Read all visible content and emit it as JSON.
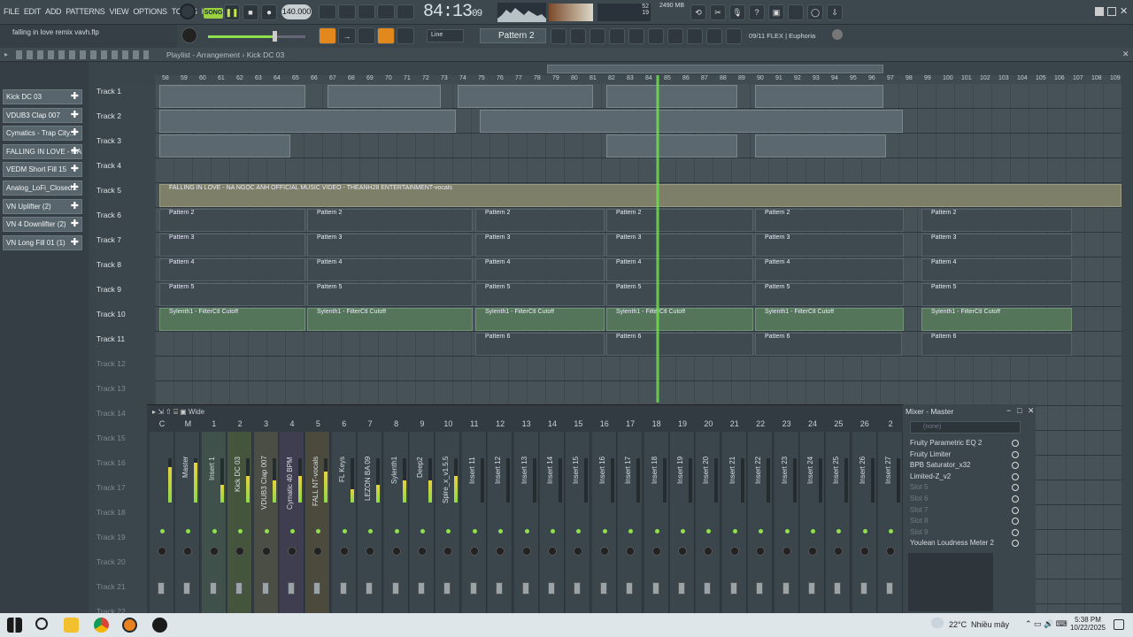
{
  "menu": [
    "FILE",
    "EDIT",
    "ADD",
    "PATTERNS",
    "VIEW",
    "OPTIONS",
    "TOOLS",
    "HELP"
  ],
  "transport": {
    "mode": "SONG",
    "tempo": "140.000",
    "time": "84:13",
    "time_sub": "09",
    "cpu_mem": "2490 MB",
    "cpu_num": "52",
    "poly": "19"
  },
  "hint": "falling in love remix vavh.flp",
  "snap": "Line",
  "pattern": "Pattern 2",
  "flex": "09/11  FLEX | Euphoria",
  "playlist_title": "Playlist - Arrangement",
  "playlist_sub": "Kick DC 03",
  "channels": [
    "Kick DC 03",
    "VDUB3 Clap 007",
    "Cymatics - Trap City...",
    "FALLING IN LOVE - NA...",
    "VEDM Short Fill 15",
    "Analog_LoFi_Closed...",
    "VN Uplifter (2)",
    "VN 4 Downlifter (2)",
    "VN Long Fill 01 (1)"
  ],
  "tracks": [
    "Track 1",
    "Track 2",
    "Track 3",
    "Track 4",
    "Track 5",
    "Track 6",
    "Track 7",
    "Track 8",
    "Track 9",
    "Track 10",
    "Track 11",
    "Track 12",
    "Track 13",
    "Track 14",
    "Track 15",
    "Track 16",
    "Track 17",
    "Track 18",
    "Track 19",
    "Track 20",
    "Track 21",
    "Track 22"
  ],
  "ruler": [
    "58",
    "59",
    "60",
    "61",
    "62",
    "63",
    "64",
    "65",
    "66",
    "67",
    "68",
    "69",
    "70",
    "71",
    "72",
    "73",
    "74",
    "75",
    "76",
    "77",
    "78",
    "79",
    "80",
    "81",
    "82",
    "83",
    "84",
    "85",
    "86",
    "87",
    "88",
    "89",
    "90",
    "91",
    "92",
    "93",
    "94",
    "95",
    "96",
    "97",
    "98",
    "99",
    "100",
    "101",
    "102",
    "103",
    "104",
    "105",
    "106",
    "107",
    "108",
    "109"
  ],
  "clips": {
    "audio": "FALLING IN LOVE - NA NGỌC ANH  OFFICIAL MUSIC VIDEO - THEANH28 ENTERTAINMENT-vocals",
    "p2": "Pattern 2",
    "p3": "Pattern 3",
    "p4": "Pattern 4",
    "p5": "Pattern 5",
    "p6": "Pattern 6",
    "auto": "Sylenth1 - FilterCtl Cutoff"
  },
  "mixer": {
    "view": "Wide",
    "title": "Mixer - Master",
    "numbers": [
      "C",
      "M",
      "1",
      "2",
      "3",
      "4",
      "5",
      "6",
      "7",
      "8",
      "9",
      "10",
      "11",
      "12",
      "13",
      "14",
      "15",
      "16",
      "17",
      "18",
      "19",
      "20",
      "21",
      "22",
      "23",
      "24",
      "25",
      "26",
      "2"
    ],
    "names": [
      "",
      "Master",
      "Insert 1",
      "Kick DC 03",
      "VDUB3 Clap 007",
      "Cymatic 40 BPM",
      "FALL NT-vocals",
      "FL Keys",
      "LEZON BA 09",
      "Sylenth1",
      "Deep2",
      "Spire_x_v1.5.5",
      "Insert 11",
      "Insert 12",
      "Insert 13",
      "Insert 14",
      "Insert 15",
      "Insert 16",
      "Insert 17",
      "Insert 18",
      "Insert 19",
      "Insert 20",
      "Insert 21",
      "Insert 22",
      "Insert 23",
      "Insert 24",
      "Insert 25",
      "Insert 26",
      "Insert 27"
    ],
    "slots_top": "(none)",
    "slots": [
      "Fruity Parametric EQ 2",
      "Fruity Limiter",
      "BPB Saturator_x32",
      "Limited-Z_v2",
      "Slot 5",
      "Slot 6",
      "Slot 7",
      "Slot 8",
      "Slot 9",
      "Youlean Loudness Meter 2"
    ]
  },
  "taskbar": {
    "weather": "22°C",
    "weather_text": "Nhiều mây",
    "time": "5:38 PM",
    "date": "10/22/2025"
  }
}
